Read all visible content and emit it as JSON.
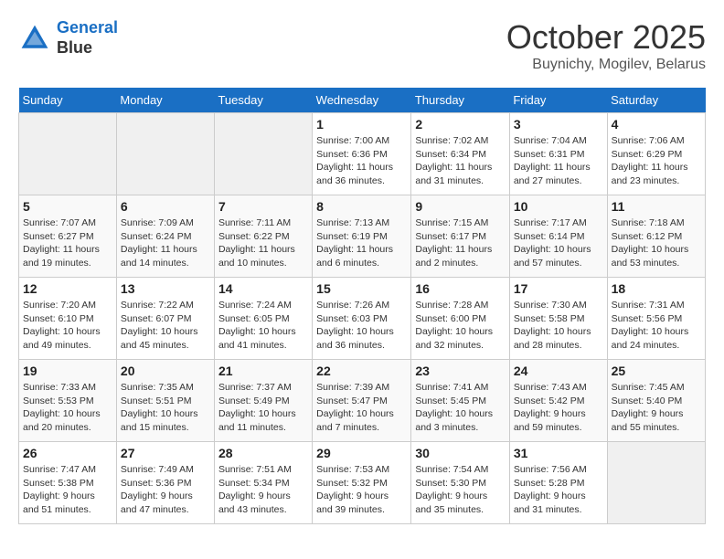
{
  "header": {
    "logo_line1": "General",
    "logo_line2": "Blue",
    "month": "October 2025",
    "location": "Buynichy, Mogilev, Belarus"
  },
  "weekdays": [
    "Sunday",
    "Monday",
    "Tuesday",
    "Wednesday",
    "Thursday",
    "Friday",
    "Saturday"
  ],
  "weeks": [
    [
      {
        "num": "",
        "info": ""
      },
      {
        "num": "",
        "info": ""
      },
      {
        "num": "",
        "info": ""
      },
      {
        "num": "1",
        "info": "Sunrise: 7:00 AM\nSunset: 6:36 PM\nDaylight: 11 hours\nand 36 minutes."
      },
      {
        "num": "2",
        "info": "Sunrise: 7:02 AM\nSunset: 6:34 PM\nDaylight: 11 hours\nand 31 minutes."
      },
      {
        "num": "3",
        "info": "Sunrise: 7:04 AM\nSunset: 6:31 PM\nDaylight: 11 hours\nand 27 minutes."
      },
      {
        "num": "4",
        "info": "Sunrise: 7:06 AM\nSunset: 6:29 PM\nDaylight: 11 hours\nand 23 minutes."
      }
    ],
    [
      {
        "num": "5",
        "info": "Sunrise: 7:07 AM\nSunset: 6:27 PM\nDaylight: 11 hours\nand 19 minutes."
      },
      {
        "num": "6",
        "info": "Sunrise: 7:09 AM\nSunset: 6:24 PM\nDaylight: 11 hours\nand 14 minutes."
      },
      {
        "num": "7",
        "info": "Sunrise: 7:11 AM\nSunset: 6:22 PM\nDaylight: 11 hours\nand 10 minutes."
      },
      {
        "num": "8",
        "info": "Sunrise: 7:13 AM\nSunset: 6:19 PM\nDaylight: 11 hours\nand 6 minutes."
      },
      {
        "num": "9",
        "info": "Sunrise: 7:15 AM\nSunset: 6:17 PM\nDaylight: 11 hours\nand 2 minutes."
      },
      {
        "num": "10",
        "info": "Sunrise: 7:17 AM\nSunset: 6:14 PM\nDaylight: 10 hours\nand 57 minutes."
      },
      {
        "num": "11",
        "info": "Sunrise: 7:18 AM\nSunset: 6:12 PM\nDaylight: 10 hours\nand 53 minutes."
      }
    ],
    [
      {
        "num": "12",
        "info": "Sunrise: 7:20 AM\nSunset: 6:10 PM\nDaylight: 10 hours\nand 49 minutes."
      },
      {
        "num": "13",
        "info": "Sunrise: 7:22 AM\nSunset: 6:07 PM\nDaylight: 10 hours\nand 45 minutes."
      },
      {
        "num": "14",
        "info": "Sunrise: 7:24 AM\nSunset: 6:05 PM\nDaylight: 10 hours\nand 41 minutes."
      },
      {
        "num": "15",
        "info": "Sunrise: 7:26 AM\nSunset: 6:03 PM\nDaylight: 10 hours\nand 36 minutes."
      },
      {
        "num": "16",
        "info": "Sunrise: 7:28 AM\nSunset: 6:00 PM\nDaylight: 10 hours\nand 32 minutes."
      },
      {
        "num": "17",
        "info": "Sunrise: 7:30 AM\nSunset: 5:58 PM\nDaylight: 10 hours\nand 28 minutes."
      },
      {
        "num": "18",
        "info": "Sunrise: 7:31 AM\nSunset: 5:56 PM\nDaylight: 10 hours\nand 24 minutes."
      }
    ],
    [
      {
        "num": "19",
        "info": "Sunrise: 7:33 AM\nSunset: 5:53 PM\nDaylight: 10 hours\nand 20 minutes."
      },
      {
        "num": "20",
        "info": "Sunrise: 7:35 AM\nSunset: 5:51 PM\nDaylight: 10 hours\nand 15 minutes."
      },
      {
        "num": "21",
        "info": "Sunrise: 7:37 AM\nSunset: 5:49 PM\nDaylight: 10 hours\nand 11 minutes."
      },
      {
        "num": "22",
        "info": "Sunrise: 7:39 AM\nSunset: 5:47 PM\nDaylight: 10 hours\nand 7 minutes."
      },
      {
        "num": "23",
        "info": "Sunrise: 7:41 AM\nSunset: 5:45 PM\nDaylight: 10 hours\nand 3 minutes."
      },
      {
        "num": "24",
        "info": "Sunrise: 7:43 AM\nSunset: 5:42 PM\nDaylight: 9 hours\nand 59 minutes."
      },
      {
        "num": "25",
        "info": "Sunrise: 7:45 AM\nSunset: 5:40 PM\nDaylight: 9 hours\nand 55 minutes."
      }
    ],
    [
      {
        "num": "26",
        "info": "Sunrise: 7:47 AM\nSunset: 5:38 PM\nDaylight: 9 hours\nand 51 minutes."
      },
      {
        "num": "27",
        "info": "Sunrise: 7:49 AM\nSunset: 5:36 PM\nDaylight: 9 hours\nand 47 minutes."
      },
      {
        "num": "28",
        "info": "Sunrise: 7:51 AM\nSunset: 5:34 PM\nDaylight: 9 hours\nand 43 minutes."
      },
      {
        "num": "29",
        "info": "Sunrise: 7:53 AM\nSunset: 5:32 PM\nDaylight: 9 hours\nand 39 minutes."
      },
      {
        "num": "30",
        "info": "Sunrise: 7:54 AM\nSunset: 5:30 PM\nDaylight: 9 hours\nand 35 minutes."
      },
      {
        "num": "31",
        "info": "Sunrise: 7:56 AM\nSunset: 5:28 PM\nDaylight: 9 hours\nand 31 minutes."
      },
      {
        "num": "",
        "info": ""
      }
    ]
  ]
}
